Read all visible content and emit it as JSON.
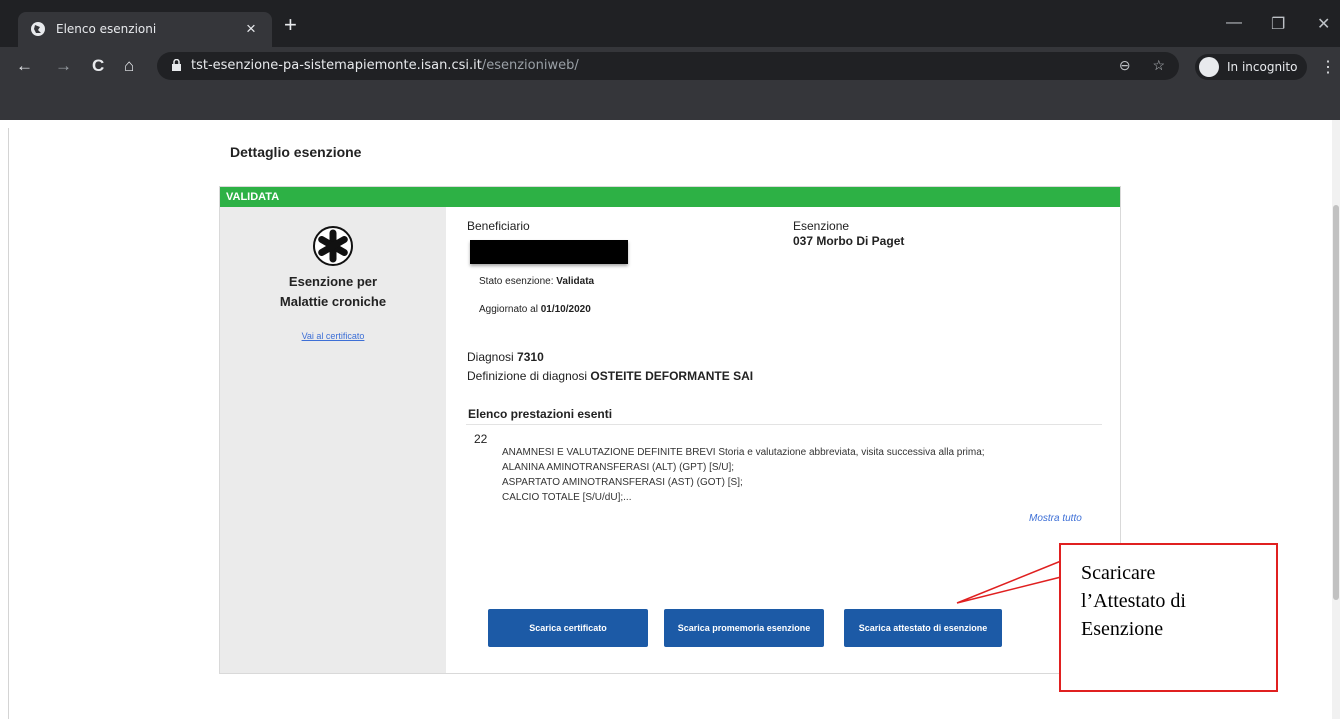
{
  "browser": {
    "tab_title": "Elenco esenzioni",
    "tab_close": "×",
    "new_tab": "+",
    "url_host": "tst-esenzione-pa-sistemapiemonte.isan.csi.it",
    "url_path": "/esenzioniweb/",
    "incognito_label": "In incognito",
    "back_icon": "←",
    "forward_icon": "→",
    "reload_icon": "C",
    "home_icon": "⌂",
    "minimize_icon": "—",
    "restore_icon": "❐",
    "close_icon": "✕",
    "zoom_icon": "⊖",
    "star_icon": "☆",
    "menu_icon": "⋮"
  },
  "page": {
    "title": "Dettaglio esenzione",
    "status": "VALIDATA",
    "status_color": "#2db145",
    "left": {
      "title_line1": "Esenzione per",
      "title_line2": "Malattie croniche",
      "cert_link": "Vai al certificato"
    },
    "beneficiary_label": "Beneficiario",
    "exemption_label": "Esenzione",
    "exemption_value": "037 Morbo Di Paget",
    "status_label": "Stato esenzione:",
    "status_value": "Validata",
    "updated_label": "Aggiornato al",
    "updated_value": "01/10/2020",
    "diagnosis_label": "Diagnosi",
    "diagnosis_value": "7310",
    "diagnosis_def_label": "Definizione di diagnosi",
    "diagnosis_def_value": "OSTEITE DEFORMANTE SAI",
    "services_title": "Elenco prestazioni esenti",
    "services_code": "22",
    "services": [
      "ANAMNESI E VALUTAZIONE DEFINITE BREVI Storia e valutazione abbreviata, visita successiva alla prima;",
      "ALANINA AMINOTRANSFERASI (ALT) (GPT) [S/U];",
      "ASPARTATO AMINOTRANSFERASI (AST) (GOT) [S];",
      "CALCIO TOTALE [S/U/dU];..."
    ],
    "show_all": "Mostra tutto",
    "buttons": {
      "certificate": "Scarica certificato",
      "reminder": "Scarica promemoria esenzione",
      "attestation": "Scarica attestato di esenzione"
    },
    "button_color": "#1c5aa6"
  },
  "annotation": {
    "line1": "Scaricare",
    "line2": "l’Attestato di",
    "line3": "Esenzione",
    "color": "#e02020"
  }
}
